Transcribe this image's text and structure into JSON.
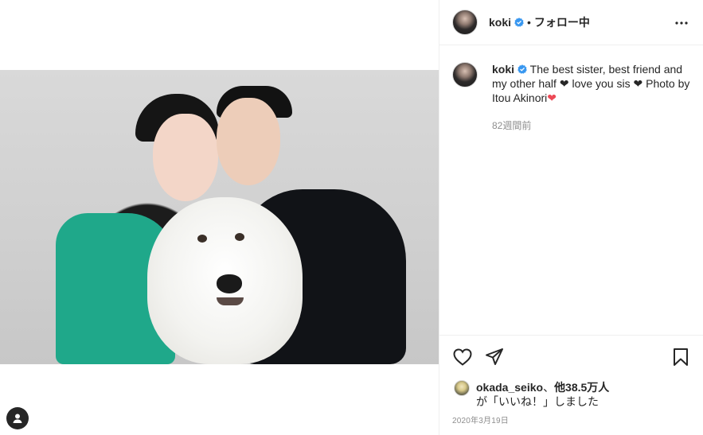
{
  "header": {
    "username": "koki",
    "separator": "•",
    "follow_state": "フォロー中"
  },
  "caption": {
    "username": "koki",
    "text_part1": " The best sister, best friend and my other half ",
    "heart1": "❤",
    "text_part2": " love you sis ",
    "heart2": "❤",
    "text_part3": " Photo by Itou Akinori",
    "heart3": "❤"
  },
  "time_ago": "82週間前",
  "likes": {
    "liker": "okada_seiko",
    "connector": "、",
    "others": "他38.5万人",
    "suffix": "が「いいね！」しました"
  },
  "date": "2020年3月19日",
  "colors": {
    "verified_blue": "#3897f0",
    "text_primary": "#262626",
    "text_secondary": "#8e8e8e",
    "heart_red": "#ed4956"
  },
  "icons": {
    "verified": "verified-badge-icon",
    "more": "more-options-icon",
    "like": "heart-icon",
    "share": "share-icon",
    "save": "bookmark-icon",
    "profile": "profile-icon"
  }
}
